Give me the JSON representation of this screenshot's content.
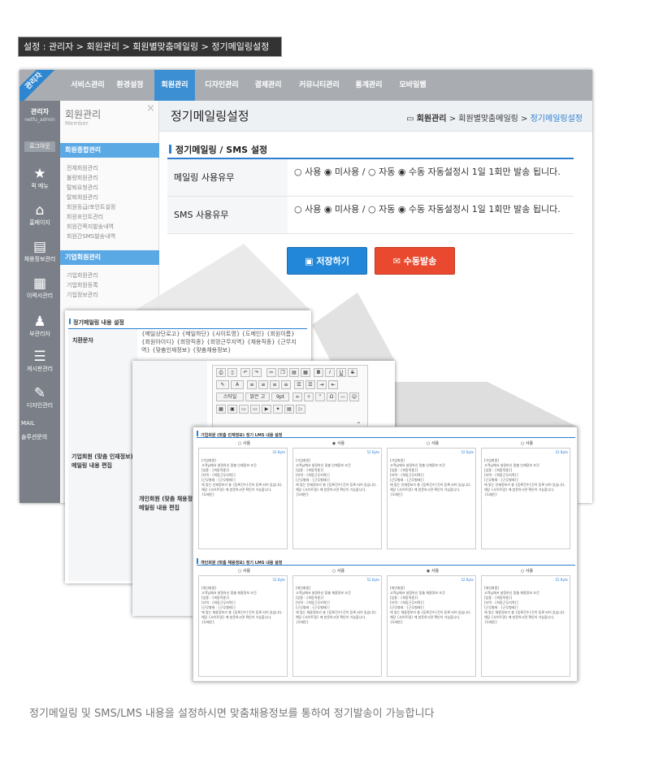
{
  "breadcrumb": "설정 : 관리자 > 회원관리 > 회원별맞춤메일링 > 정기메일링설정",
  "ribbon": "관리자",
  "nav": [
    "서비스관리",
    "환경설정",
    "회원관리",
    "디자인관리",
    "결제관리",
    "커뮤니티관리",
    "통계관리",
    "모바일웹"
  ],
  "left": {
    "admin": "관리자",
    "admin_id": "netfu_admin",
    "logout": "로그아웃",
    "items": [
      "퀵 메뉴",
      "홈페이지",
      "채용정보관리",
      "이력서관리",
      "부관리자",
      "게시판관리",
      "디자인관리"
    ],
    "mail": "MAIL",
    "solution": "솔루션문의"
  },
  "submenu": {
    "title": "회원관리",
    "subtitle": "Member",
    "sec1": "회원종합관리",
    "links1": [
      "전체회원관리",
      "불량회원관리",
      "탈퇴요청관리",
      "탈퇴회원관리",
      "회원등급/포인트설정",
      "회원포인트관리",
      "회원간쪽지발송내역",
      "회원간SMS발송내역"
    ],
    "sec2": "기업회원관리",
    "links2": [
      "기업회원관리",
      "기업회원등록",
      "기업정보관리"
    ]
  },
  "page": {
    "title": "정기메일링설정",
    "bc_home": "회원관리",
    "bc_rest": " > 회원별맞춤메일링 > ",
    "bc_cur": "정기메일링설정",
    "section": "정기메일링 / SMS 설정",
    "rows": [
      {
        "label": "메일링 사용유무",
        "value": "○ 사용 ◉ 미사용   /   ○ 자동 ◉ 수동  자동설정시 1일 1회만 발송 됩니다."
      },
      {
        "label": "SMS 사용유무",
        "value": "○ 사용 ◉ 미사용   /   ○ 자동 ◉ 수동  자동설정시 1일 1회만 발송 됩니다."
      }
    ],
    "save": "저장하기",
    "send": "수동발송"
  },
  "ov1": {
    "title": "정기메일링 내용 설정",
    "label1": "치환문자",
    "text1": "{메일상단로고} {메일하단} {사이트명} {도메인} {회원이름} {회원아이디} {희망직종} {희망근무지역} {채용직종} {근무지역} {맞춤인재정보} {맞춤채용정보}",
    "label2": "기업회원 (맞춤 인재정보) 메일링 내용 편집"
  },
  "ov2": {
    "label": "개인회원 (맞춤 채용정보) 메일링 내용 편집",
    "tb1": [
      "B",
      "I",
      "U",
      "S"
    ],
    "tb_style": "스타일",
    "tb_font": "맑은 고",
    "tb_size": "9pt"
  },
  "ov3": {
    "title1": "기업회원 (맞춤 인재정보) 정기 LMS 내용 설정",
    "title2": "개인회원 (맞춤 채용정보) 정기 LMS 내용 설정",
    "use": "사용",
    "card1": "[기업회원]\n고객님께서 설정하신 맞춤 인재정보 조건\n[업종 : {희망직종}]\n[지역 : {희망근무지역}]\n[근무형태 : {근무형태}]\n에 맞는 인재정보가 총 {등록건수}건이 등록 되어 있습니다.\n해당 {사이트명} 에 방문하시면 확인이 가능합니다.\n{도메인}",
    "card2": "[개인회원]\n고객님께서 설정하신 맞춤 채용정보 조건\n[업종 : {희망직종}]\n[지역 : {희망근무지역}]\n[근무형태 : {근무형태}]\n에 맞는 채용정보가 총 {등록건수}건이 등록 되어 있습니다.\n해당 {사이트명} 에 방문하시면 확인이 가능합니다.\n{도메인}",
    "bytes": "52 Byte"
  },
  "caption": "정기메일링 및 SMS/LMS 내용을 설정하시면 맞춤채용정보를 통하여 정기발송이 가능합니다"
}
